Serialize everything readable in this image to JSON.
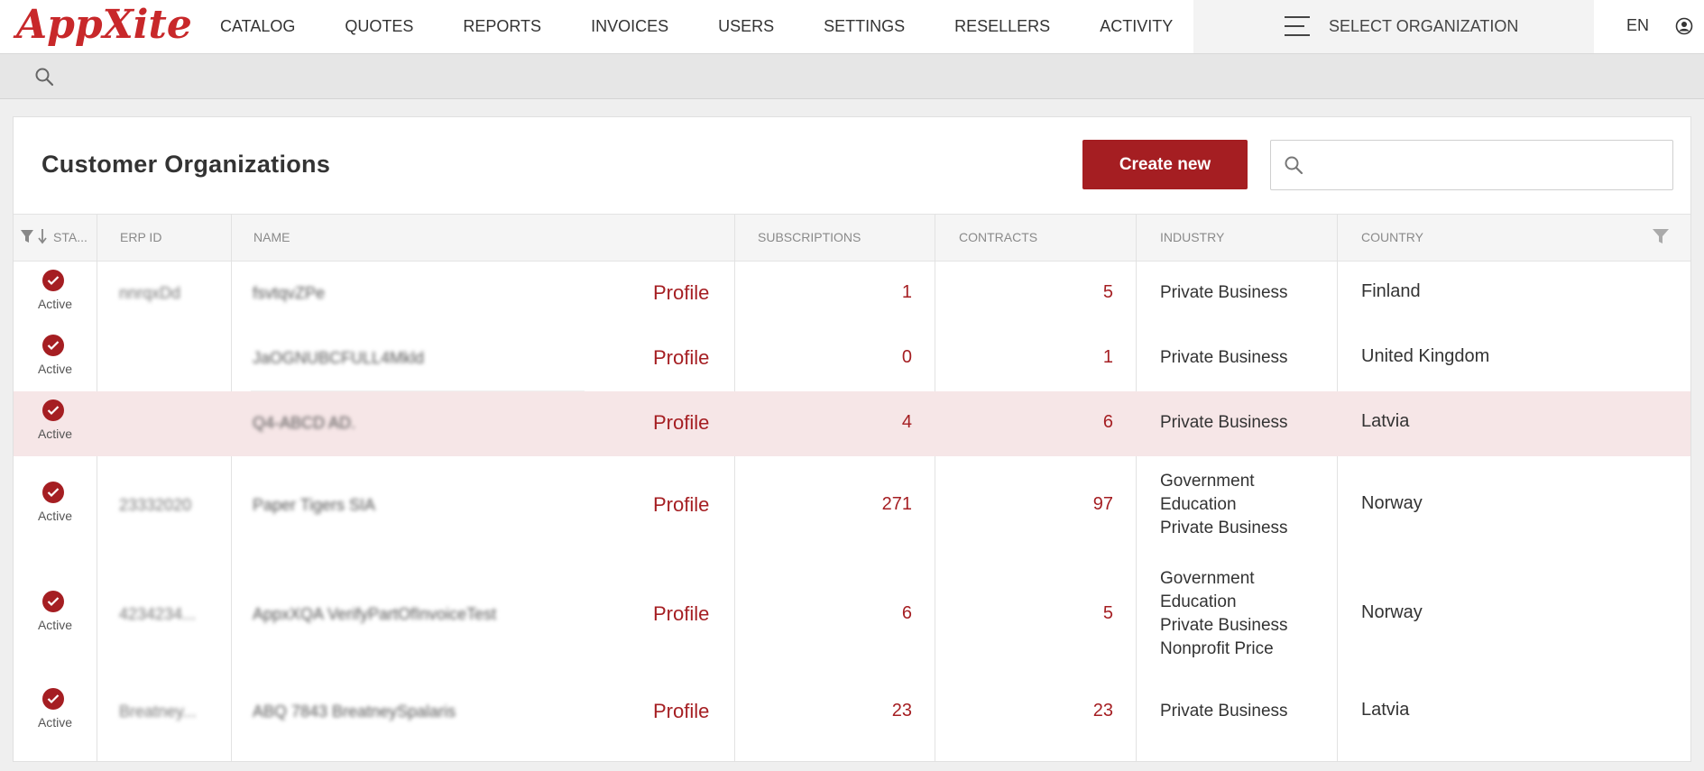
{
  "brand": {
    "logo_text": "AppXite",
    "accent": "#a51e22"
  },
  "nav": {
    "items": [
      "CATALOG",
      "QUOTES",
      "REPORTS",
      "INVOICES",
      "USERS",
      "SETTINGS",
      "RESELLERS",
      "ACTIVITY"
    ],
    "org_select_label": "SELECT ORGANIZATION",
    "language": "EN"
  },
  "page": {
    "title": "Customer Organizations",
    "create_button": "Create new",
    "search_placeholder": ""
  },
  "table": {
    "columns": [
      "STA...",
      "ERP ID",
      "NAME",
      "SUBSCRIPTIONS",
      "CONTRACTS",
      "INDUSTRY",
      "COUNTRY"
    ],
    "rows": [
      {
        "status": "Active",
        "erp_id": "nnrqxDd",
        "name": "fsvtqvZPe",
        "profile": "Profile",
        "subscriptions": "1",
        "contracts": "5",
        "industry": [
          "Private Business"
        ],
        "country": "Finland"
      },
      {
        "status": "Active",
        "erp_id": "",
        "name": "JaOGNUBCFULL4Mkld",
        "profile": "Profile",
        "subscriptions": "0",
        "contracts": "1",
        "industry": [
          "Private Business"
        ],
        "country": "United Kingdom"
      },
      {
        "status": "Active",
        "erp_id": "",
        "name": "Q4-ABCD AD.",
        "profile": "Profile",
        "subscriptions": "4",
        "contracts": "6",
        "industry": [
          "Private Business"
        ],
        "country": "Latvia"
      },
      {
        "status": "Active",
        "erp_id": "23332020",
        "name": "Paper Tigers SIA",
        "profile": "Profile",
        "subscriptions": "271",
        "contracts": "97",
        "industry": [
          "Government",
          "Education",
          "Private Business"
        ],
        "country": "Norway"
      },
      {
        "status": "Active",
        "erp_id": "4234234...",
        "name": "AppxXQA VerifyPartOfInvoiceTest",
        "profile": "Profile",
        "subscriptions": "6",
        "contracts": "5",
        "industry": [
          "Government",
          "Education",
          "Private Business",
          "Nonprofit Price"
        ],
        "country": "Norway"
      },
      {
        "status": "Active",
        "erp_id": "Breatney...",
        "name": "ABQ 7843 BreatneySpalaris",
        "profile": "Profile",
        "subscriptions": "23",
        "contracts": "23",
        "industry": [
          "Private Business"
        ],
        "country": "Latvia"
      }
    ]
  }
}
